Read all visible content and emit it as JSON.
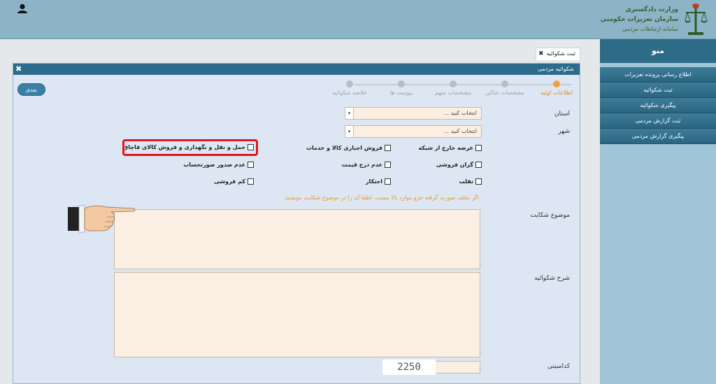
{
  "header": {
    "org_line1": "وزارت دادگستری",
    "org_line2": "سازمان تعزیرات حکومتی",
    "org_line3": "سامانه ارتباطات مردمی",
    "user_icon": "user-icon",
    "emblem_icon": "scales-emblem-icon"
  },
  "sidebar": {
    "title": "منو",
    "items": [
      {
        "label": "اطلاع رسانی پرونده تعزیرات"
      },
      {
        "label": "ثبت شکوائیه"
      },
      {
        "label": "پیگیری شکوائیه"
      },
      {
        "label": "ثبت گزارش مردمی"
      },
      {
        "label": "پیگیری گزارش مردمی"
      }
    ]
  },
  "tab": {
    "label": "ثبت شکوائیه",
    "close": "✖"
  },
  "panel": {
    "title": "شکوائیه مردمی",
    "close": "✖",
    "next_button": "بعدی",
    "steps": [
      {
        "label": "اطلاعات اولیه",
        "active": true
      },
      {
        "label": "مشخصات شاکی",
        "active": false
      },
      {
        "label": "مشخصات متهم",
        "active": false
      },
      {
        "label": "پیوست ها",
        "active": false
      },
      {
        "label": "خلاصه شکوائیه",
        "active": false
      }
    ],
    "province_label": "استان",
    "province_value": "انتخاب کنید ...",
    "city_label": "شهر",
    "city_value": "انتخاب کنید ...",
    "violations": [
      {
        "label": "عرضه خارج از شبکه",
        "checked": false
      },
      {
        "label": "فروش اجباری کالا و خدمات",
        "checked": false
      },
      {
        "label": "حمل و نقل و نگهداری و فروش کالای قاچاق",
        "checked": false
      },
      {
        "label": "گران فروشی",
        "checked": false
      },
      {
        "label": "عدم درج قیمت",
        "checked": false
      },
      {
        "label": "عدم صدور صورتحساب",
        "checked": false
      },
      {
        "label": "تقلب",
        "checked": false
      },
      {
        "label": "احتکار",
        "checked": false
      },
      {
        "label": "کم فروشی",
        "checked": false
      }
    ],
    "note": "اگر تخلف صورت گرفته جزو موارد بالا نیست، لطفا آن را در موضوع شکایت بنویسید",
    "subject_label": "موضوع شکایت",
    "description_label": "شرح شکوائیه",
    "captcha_label": "کدامنیتی",
    "captcha_value": "2250",
    "colors": {
      "accent": "#2b6b8c",
      "highlight": "#e3161c",
      "active_step": "#f0a13a"
    }
  }
}
